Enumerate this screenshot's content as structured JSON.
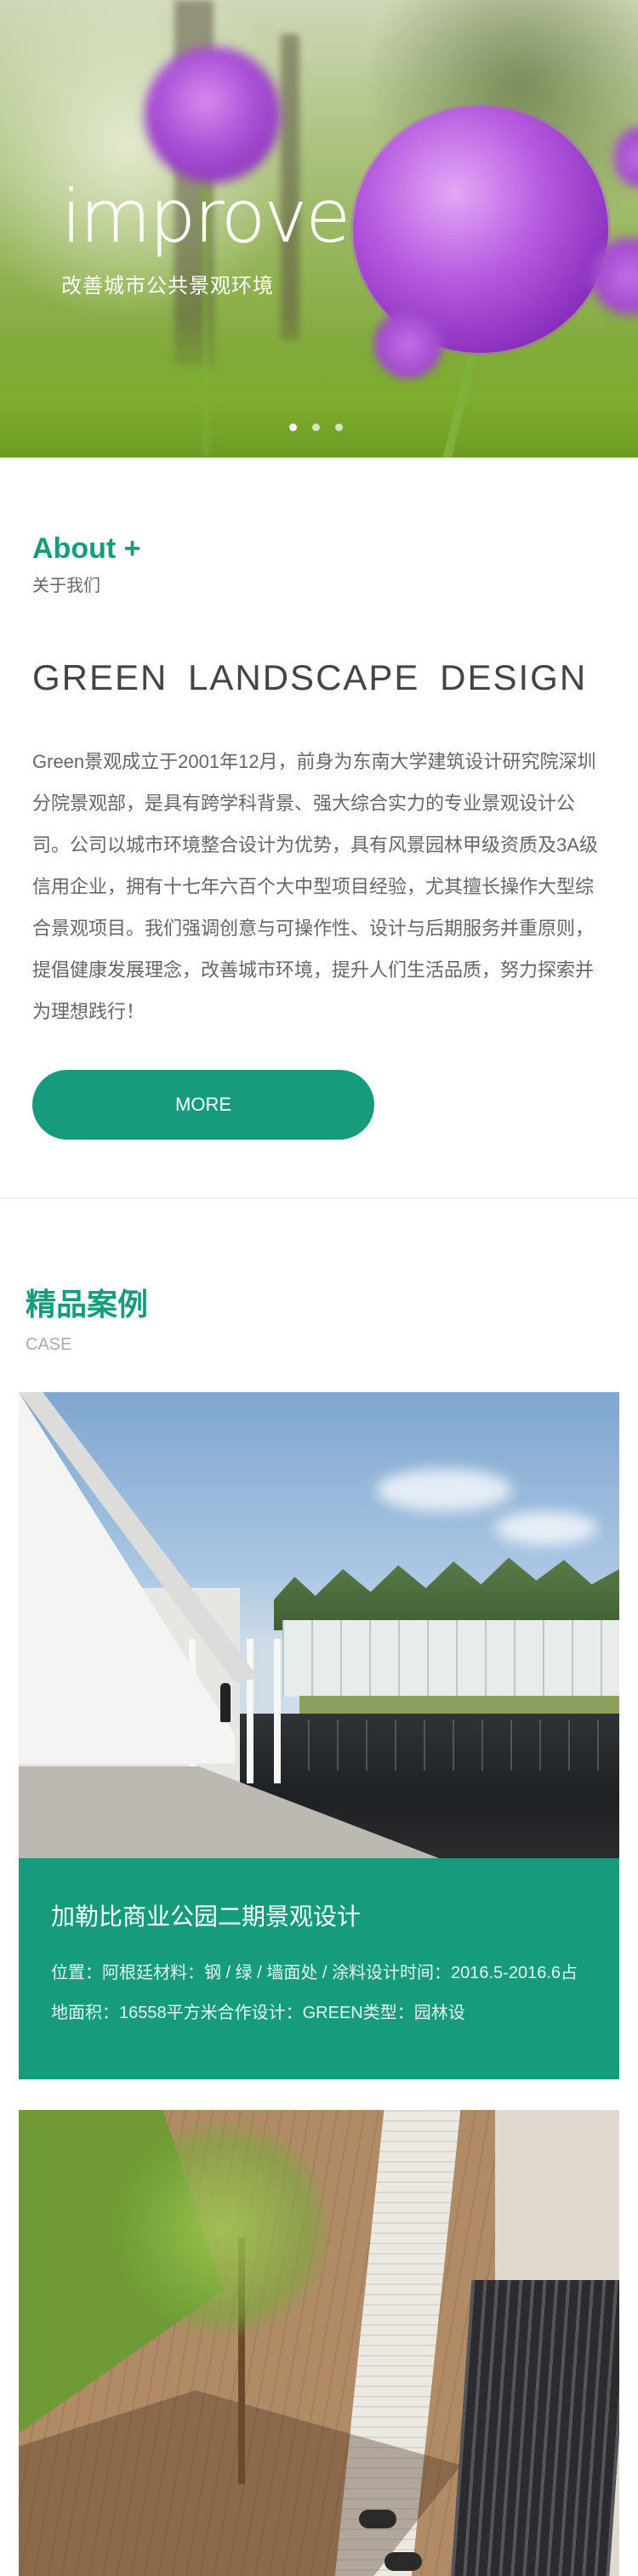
{
  "hero": {
    "title": "improve",
    "subtitle": "改善城市公共景观环境",
    "slides": 3,
    "active_slide": 1
  },
  "about": {
    "heading": "About +",
    "subheading": "关于我们",
    "title": "GREEN LANDSCAPE DESIGN",
    "text": "Green景观成立于2001年12月，前身为东南大学建筑设计研究院深圳分院景观部，是具有跨学科背景、强大综合实力的专业景观设计公司。公司以城市环境整合设计为优势，具有风景园林甲级资质及3A级信用企业，拥有十七年六百个大中型项目经验，尤其擅长操作大型综合景观项目。我们强调创意与可操作性、设计与后期服务并重原则，提倡健康发展理念，改善城市环境，提升人们生活品质，努力探索并为理想践行！",
    "more_label": "MORE"
  },
  "cases": {
    "heading": "精品案例",
    "subheading": "CASE",
    "items": [
      {
        "title": "加勒比商业公园二期景观设计",
        "desc": "位置：阿根廷材料：钢 / 绿 / 墙面处 / 涂料设计时间：2016.5-2016.6占地面积：16558平方米合作设计：GREEN类型：园林设"
      }
    ]
  },
  "colors": {
    "accent": "#169c7d",
    "text": "#555555"
  }
}
